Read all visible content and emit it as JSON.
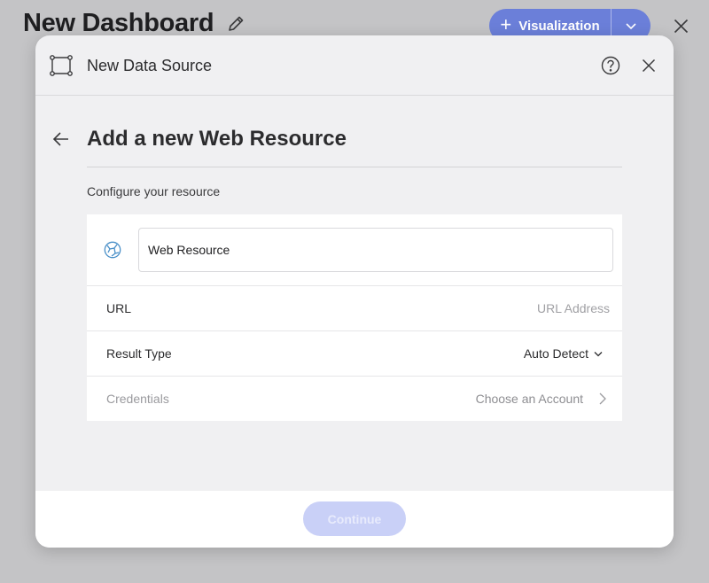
{
  "dashboard": {
    "title": "New Dashboard",
    "visualization_button": "Visualization"
  },
  "modal": {
    "title": "New Data Source",
    "heading": "Add a new Web Resource",
    "subtitle": "Configure your resource",
    "name_value": "Web Resource",
    "url": {
      "label": "URL",
      "placeholder": "URL Address",
      "value": ""
    },
    "result_type": {
      "label": "Result Type",
      "value": "Auto Detect"
    },
    "credentials": {
      "label": "Credentials",
      "value": "Choose an Account"
    },
    "continue_label": "Continue"
  },
  "colors": {
    "accent": "#6b7fd9",
    "continue_disabled": "#c9d0f7",
    "globe_icon": "#4a90c8"
  }
}
